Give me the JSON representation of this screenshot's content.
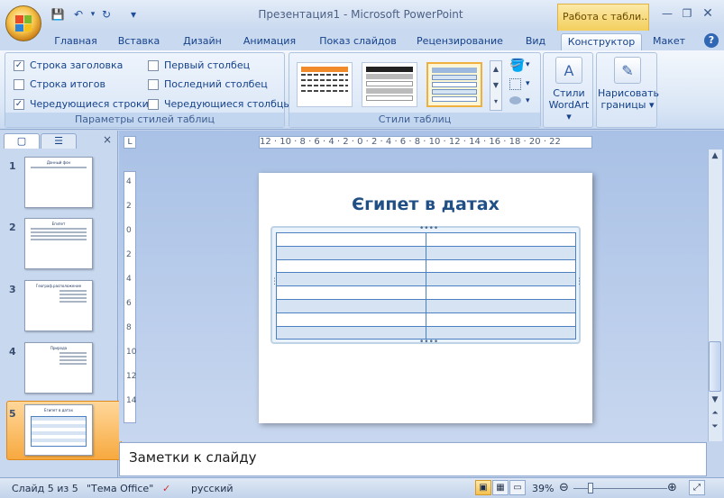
{
  "window": {
    "title": "Презентация1 - Microsoft PowerPoint",
    "contextual_tab_header": "Работа с табли..."
  },
  "quick_access": {
    "save": "💾",
    "undo": "↶",
    "redo": "↻",
    "more": "▾"
  },
  "tabs": [
    "Главная",
    "Вставка",
    "Дизайн",
    "Анимация",
    "Показ слайдов",
    "Рецензирование",
    "Вид",
    "Конструктор",
    "Макет"
  ],
  "active_tab": "Конструктор",
  "ribbon": {
    "style_options": {
      "label": "Параметры стилей таблиц",
      "options": [
        {
          "label": "Строка заголовка",
          "checked": true
        },
        {
          "label": "Строка итогов",
          "checked": false
        },
        {
          "label": "Чередующиеся строки",
          "checked": true
        },
        {
          "label": "Первый столбец",
          "checked": false
        },
        {
          "label": "Последний столбец",
          "checked": false
        },
        {
          "label": "Чередующиеся столбцы",
          "checked": false
        }
      ]
    },
    "table_styles": {
      "label": "Стили таблиц"
    },
    "wordart": {
      "line1": "Стили",
      "line2": "WordArt"
    },
    "draw_borders": {
      "line1": "Нарисовать",
      "line2": "границы"
    }
  },
  "ruler": {
    "horizontal": "12 · 10 · 8 · 6 · 4 · 2 · 0 · 2 · 4 · 6 · 8 · 10 · 12 · 14 · 16 · 18 · 20 · 22",
    "vertical": [
      "4",
      "2",
      "0",
      "2",
      "4",
      "6",
      "8",
      "10",
      "12",
      "14"
    ]
  },
  "slides": [
    {
      "num": "1",
      "title": "Данный фон"
    },
    {
      "num": "2",
      "title": "Египет"
    },
    {
      "num": "3",
      "title": "Географ.расположение"
    },
    {
      "num": "4",
      "title": "Природа"
    },
    {
      "num": "5",
      "title": "Египет в датах"
    }
  ],
  "slide": {
    "title": "Єгипет в датах",
    "table": {
      "rows": 8,
      "cols": 2
    }
  },
  "notes_placeholder": "Заметки к слайду",
  "status": {
    "slide_position": "Слайд 5 из 5",
    "theme": "\"Тема Office\"",
    "language": "русский",
    "zoom": "39%"
  },
  "colors": {
    "accent": "#15428b",
    "table_line": "#4c80c0",
    "table_band": "#d6e3f3"
  }
}
